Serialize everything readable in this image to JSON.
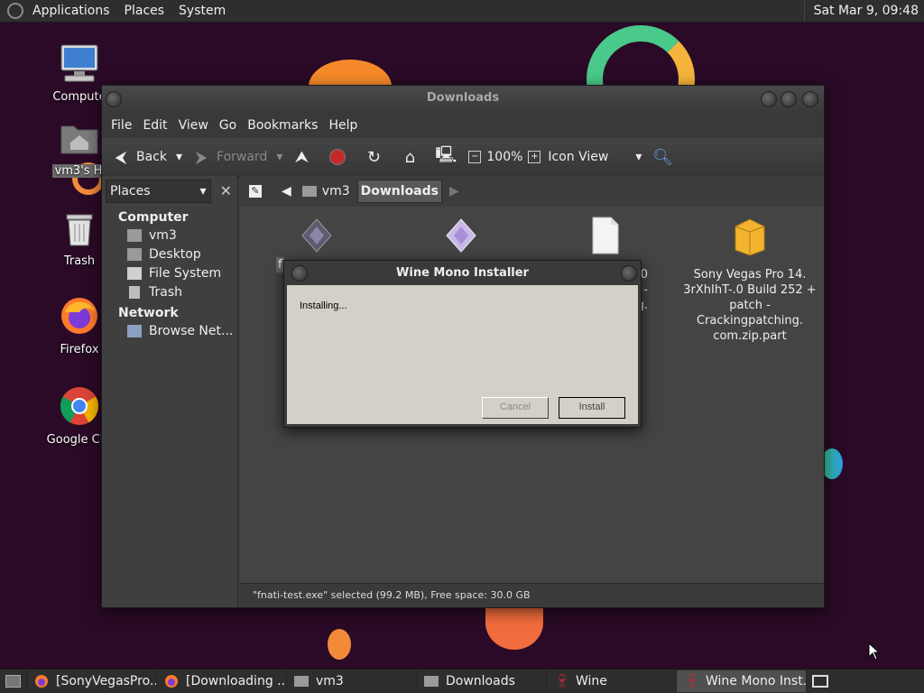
{
  "top_panel": {
    "menus": [
      "Applications",
      "Places",
      "System"
    ],
    "clock": "Sat Mar  9, 09:48"
  },
  "desktop_icons": [
    {
      "label": "Compute",
      "icon": "computer-icon"
    },
    {
      "label": "vm3's Ho",
      "icon": "home-folder-icon"
    },
    {
      "label": "Trash",
      "icon": "trash-icon"
    },
    {
      "label": "Firefox",
      "icon": "firefox-icon"
    },
    {
      "label": "Google Chr",
      "icon": "chrome-icon"
    }
  ],
  "file_manager": {
    "title": "Downloads",
    "menubar": [
      "File",
      "Edit",
      "View",
      "Go",
      "Bookmarks",
      "Help"
    ],
    "toolbar": {
      "back": "Back",
      "forward": "Forward",
      "zoom": "100%",
      "view_mode": "Icon View"
    },
    "sidebar": {
      "combo": "Places",
      "sections": [
        {
          "title": "Computer",
          "items": [
            "vm3",
            "Desktop",
            "File System",
            "Trash"
          ]
        },
        {
          "title": "Network",
          "items": [
            "Browse Net..."
          ]
        }
      ]
    },
    "pathbar": [
      "vm3",
      "Downloads"
    ],
    "files": [
      {
        "label": "f",
        "icon": "exe-file-icon"
      },
      {
        "label": "",
        "icon": "exe-file-icon"
      },
      {
        "label": "14.0\nh -\ng.",
        "icon": "blank-file-icon"
      },
      {
        "label": "Sony Vegas Pro 14.\n3rXhIhT-.0 Build 252 +\npatch -\nCrackingpatching.\ncom.zip.part",
        "icon": "archive-file-icon"
      }
    ],
    "status": "\"fnati-test.exe\" selected (99.2 MB), Free space: 30.0 GB"
  },
  "wine_dialog": {
    "title": "Wine Mono Installer",
    "status": "Installing...",
    "cancel": "Cancel",
    "install": "Install"
  },
  "taskbar": {
    "items": [
      {
        "label": "[SonyVegasPro...",
        "icon": "firefox-icon",
        "active": false
      },
      {
        "label": "[Downloading ...",
        "icon": "firefox-icon",
        "active": false
      },
      {
        "label": "vm3",
        "icon": "folder-icon",
        "active": false
      },
      {
        "label": "Downloads",
        "icon": "folder-icon",
        "active": false
      },
      {
        "label": "Wine",
        "icon": "wine-icon",
        "active": false
      },
      {
        "label": "Wine Mono Inst...",
        "icon": "wine-icon",
        "active": true
      }
    ]
  }
}
